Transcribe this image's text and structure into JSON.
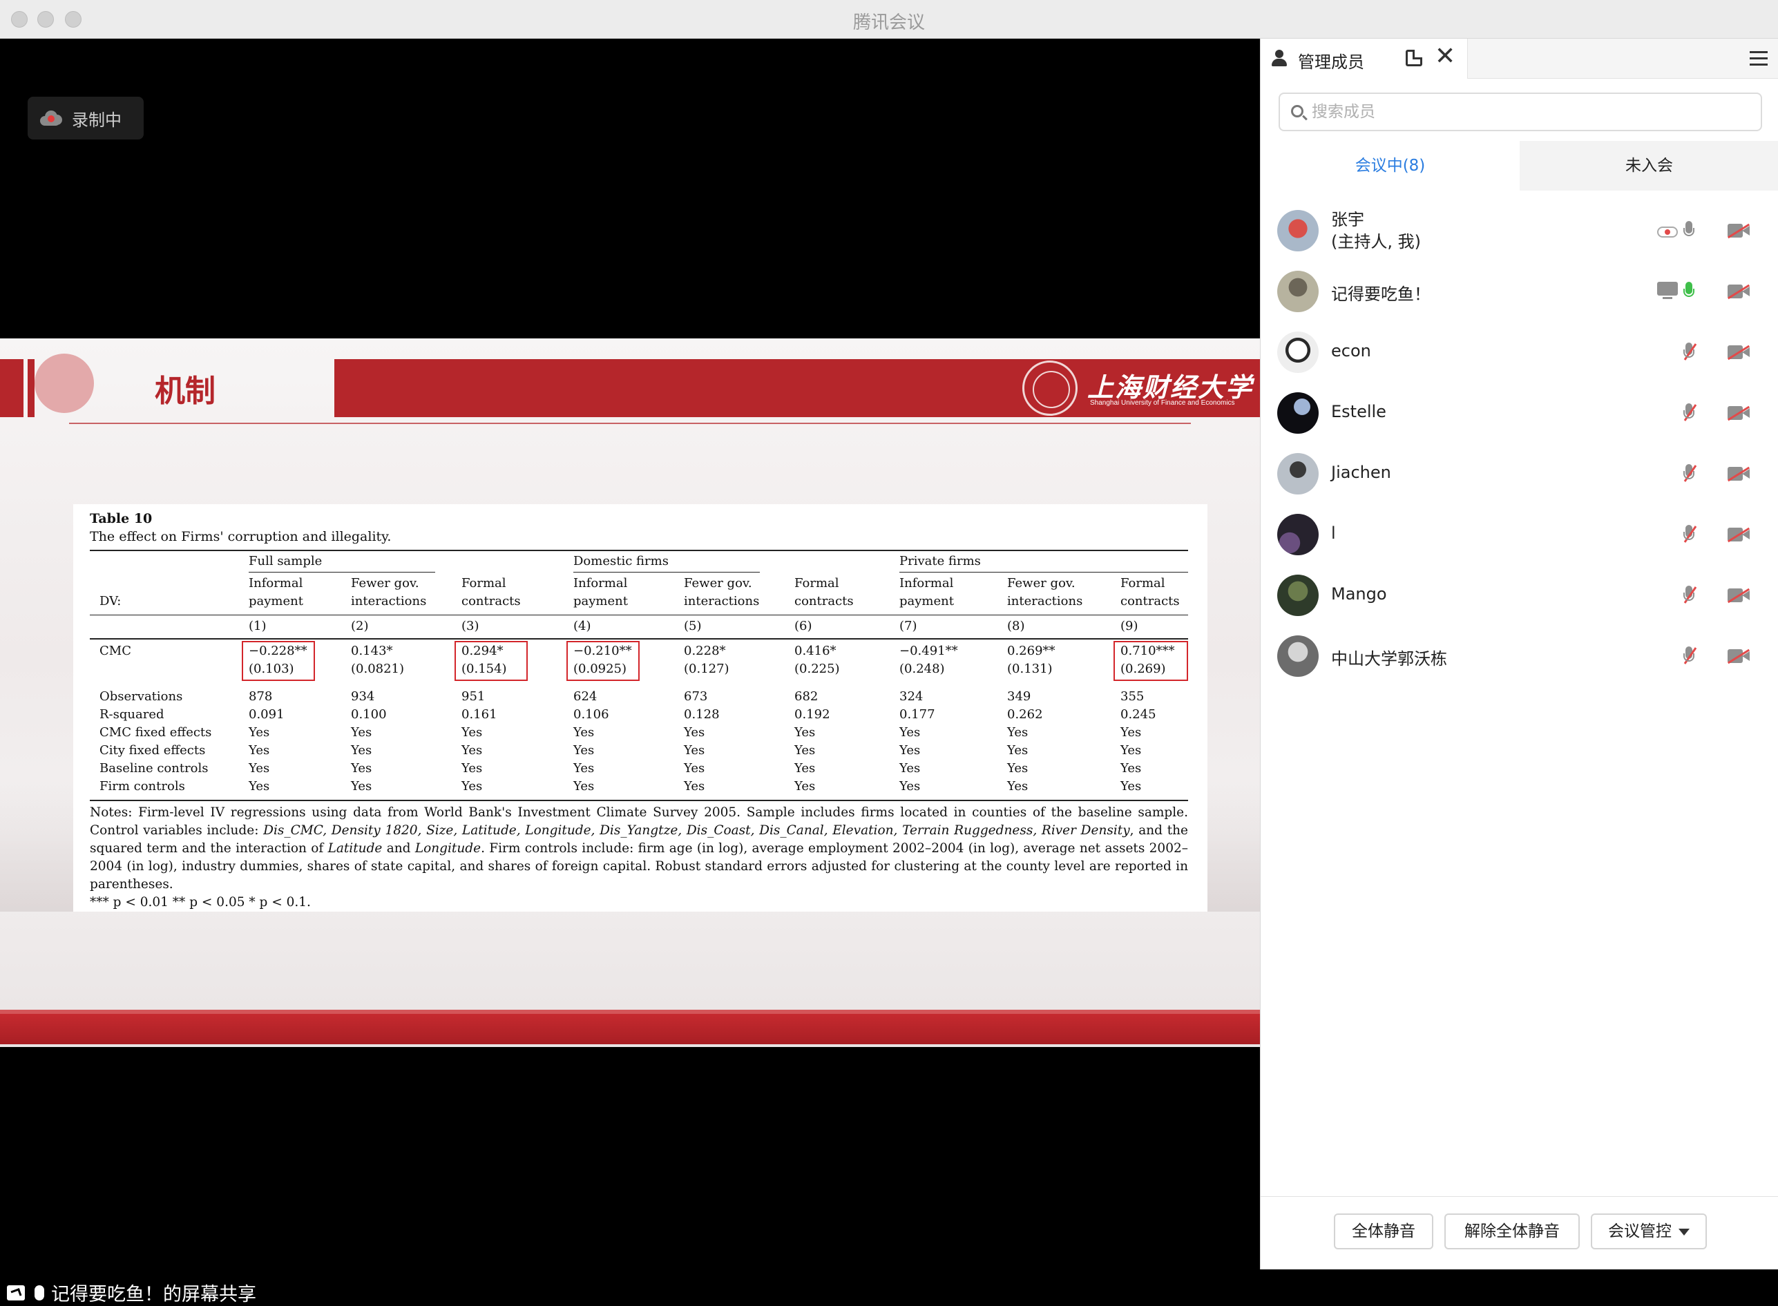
{
  "window": {
    "title": "腾讯会议"
  },
  "recording": {
    "label": "录制中"
  },
  "slide": {
    "title": "机制",
    "logo_text": "上海财经大学",
    "logo_subtext": "Shanghai University of Finance and Economics",
    "table": {
      "caption": "Table 10",
      "subtitle": "The effect on Firms' corruption and illegality.",
      "groups": [
        "Full sample",
        "Domestic firms",
        "Private firms"
      ],
      "dv_label": "DV:",
      "col_headers": [
        [
          "Informal",
          "payment"
        ],
        [
          "Fewer gov.",
          "interactions"
        ],
        [
          "Formal",
          "contracts"
        ],
        [
          "Informal",
          "payment"
        ],
        [
          "Fewer gov.",
          "interactions"
        ],
        [
          "Formal",
          "contracts"
        ],
        [
          "Informal",
          "payment"
        ],
        [
          "Fewer gov.",
          "interactions"
        ],
        [
          "Formal",
          "contracts"
        ]
      ],
      "col_numbers": [
        "(1)",
        "(2)",
        "(3)",
        "(4)",
        "(5)",
        "(6)",
        "(7)",
        "(8)",
        "(9)"
      ],
      "cmc_label": "CMC",
      "cmc_coef": [
        "−0.228**",
        "0.143*",
        "0.294*",
        "−0.210**",
        "0.228*",
        "0.416*",
        "−0.491**",
        "0.269**",
        "0.710***"
      ],
      "cmc_se": [
        "(0.103)",
        "(0.0821)",
        "(0.154)",
        "(0.0925)",
        "(0.127)",
        "(0.225)",
        "(0.248)",
        "(0.131)",
        "(0.269)"
      ],
      "highlighted_cols": [
        1,
        3,
        4,
        9
      ],
      "rows": [
        {
          "label": "Observations",
          "values": [
            "878",
            "934",
            "951",
            "624",
            "673",
            "682",
            "324",
            "349",
            "355"
          ]
        },
        {
          "label": "R-squared",
          "values": [
            "0.091",
            "0.100",
            "0.161",
            "0.106",
            "0.128",
            "0.192",
            "0.177",
            "0.262",
            "0.245"
          ]
        },
        {
          "label": "CMC fixed effects",
          "values": [
            "Yes",
            "Yes",
            "Yes",
            "Yes",
            "Yes",
            "Yes",
            "Yes",
            "Yes",
            "Yes"
          ]
        },
        {
          "label": "City fixed effects",
          "values": [
            "Yes",
            "Yes",
            "Yes",
            "Yes",
            "Yes",
            "Yes",
            "Yes",
            "Yes",
            "Yes"
          ]
        },
        {
          "label": "Baseline controls",
          "values": [
            "Yes",
            "Yes",
            "Yes",
            "Yes",
            "Yes",
            "Yes",
            "Yes",
            "Yes",
            "Yes"
          ]
        },
        {
          "label": "Firm controls",
          "values": [
            "Yes",
            "Yes",
            "Yes",
            "Yes",
            "Yes",
            "Yes",
            "Yes",
            "Yes",
            "Yes"
          ]
        }
      ],
      "notes_parts": [
        "Notes: Firm-level IV regressions using data from World Bank's Investment Climate Survey 2005. Sample includes firms located in counties of the baseline sample. Control variables include: ",
        "Dis_CMC, Density 1820, Size, Latitude, Longitude, Dis_Yangtze, Dis_Coast, Dis_Canal, Elevation, Terrain Ruggedness, River Density",
        ", and the squared term and the interaction of ",
        "Latitude",
        " and ",
        "Longitude",
        ". Firm controls include: firm age (in log), average employment 2002–2004 (in log), average net assets 2002–2004 (in log), industry dummies, shares of state capital, and shares of foreign capital. Robust standard errors adjusted for clustering at the county level are reported in parentheses."
      ],
      "signif": "*** p < 0.01 ** p < 0.05 * p < 0.1."
    }
  },
  "share_caption": "记得要吃鱼！的屏幕共享",
  "panel": {
    "tab_label": "管理成员",
    "close_glyph": "✕",
    "search_placeholder": "搜索成员",
    "tab_in_meeting": "会议中(8)",
    "tab_not_joined": "未入会",
    "members": [
      {
        "name": "张宇",
        "role": "(主持人, 我)",
        "icons": [
          "cloud",
          "mic",
          "cam-off"
        ]
      },
      {
        "name": "记得要吃鱼！",
        "icons": [
          "screen",
          "mic-green",
          "cam-off"
        ]
      },
      {
        "name": "econ",
        "icons": [
          "mic-off",
          "cam-off"
        ]
      },
      {
        "name": "Estelle",
        "icons": [
          "mic-off",
          "cam-off"
        ]
      },
      {
        "name": "Jiachen",
        "icons": [
          "mic-off",
          "cam-off"
        ]
      },
      {
        "name": "l",
        "icons": [
          "mic-off",
          "cam-off"
        ]
      },
      {
        "name": "Mango",
        "icons": [
          "mic-off",
          "cam-off"
        ]
      },
      {
        "name": "中山大学郭沃栋",
        "icons": [
          "mic-off",
          "cam-off"
        ]
      }
    ],
    "buttons": {
      "mute_all": "全体静音",
      "unmute_all": "解除全体静音",
      "controls": "会议管控"
    }
  }
}
